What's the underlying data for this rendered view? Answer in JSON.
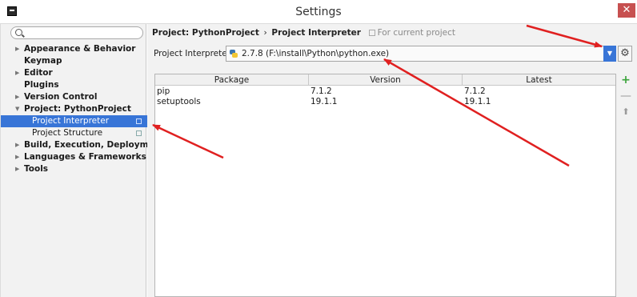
{
  "window": {
    "title": "Settings",
    "close_glyph": "✕"
  },
  "sidebar": {
    "search_value": "",
    "items": [
      {
        "label": "Appearance & Behavior",
        "arrow": "▶"
      },
      {
        "label": "Keymap",
        "arrow": ""
      },
      {
        "label": "Editor",
        "arrow": "▶"
      },
      {
        "label": "Plugins",
        "arrow": ""
      },
      {
        "label": "Version Control",
        "arrow": "▶"
      },
      {
        "label": "Project: PythonProject",
        "arrow": "▼"
      },
      {
        "label": "Project Interpreter",
        "arrow": "",
        "child": true,
        "selected": true
      },
      {
        "label": "Project Structure",
        "arrow": "",
        "child": true
      },
      {
        "label": "Build, Execution, Deployment",
        "arrow": "▶"
      },
      {
        "label": "Languages & Frameworks",
        "arrow": "▶"
      },
      {
        "label": "Tools",
        "arrow": "▶"
      }
    ]
  },
  "breadcrumb": {
    "project": "Project: PythonProject",
    "separator": "›",
    "page": "Project Interpreter",
    "scope": "For current project"
  },
  "interpreter": {
    "label": "Project Interpreter:",
    "value": "2.7.8 (F:\\install\\Python\\python.exe)",
    "dropdown_glyph": "▼",
    "gear_glyph": "⚙"
  },
  "packages": {
    "columns": [
      "Package",
      "Version",
      "Latest"
    ],
    "rows": [
      [
        "pip",
        "7.1.2",
        "7.1.2"
      ],
      [
        "setuptools",
        "19.1.1",
        "19.1.1"
      ]
    ]
  },
  "tools": {
    "add": "+",
    "remove": "—",
    "upgrade": "⬆"
  },
  "colors": {
    "selection": "#3875d7",
    "annotation": "#e02020",
    "add": "#3aa33a"
  }
}
